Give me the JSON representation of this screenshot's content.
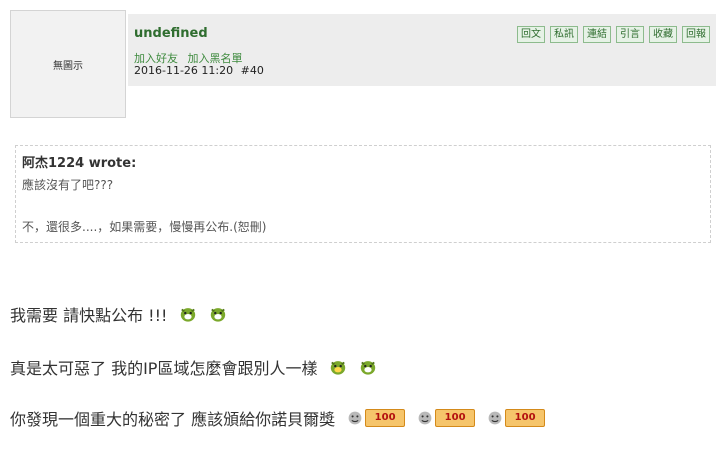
{
  "avatar": {
    "placeholder": "無圖示"
  },
  "header": {
    "username": "undefined",
    "links": [
      "加入好友",
      "加入黑名單"
    ],
    "timestamp": "2016-11-26 11:20",
    "post_number": "#40",
    "actions": [
      "回文",
      "私訊",
      "連結",
      "引言",
      "收藏",
      "回報"
    ]
  },
  "quote": {
    "author": "阿杰1224 wrote:",
    "text": "應該沒有了吧???",
    "reply": "不，還很多....，如果需要，慢慢再公布.(恕刪)"
  },
  "replies": [
    {
      "text": "我需要 請快點公布 !!!",
      "emojis": [
        "alien-face-icon",
        "alien-face-icon"
      ]
    },
    {
      "text": "真是太可惡了 我的IP區域怎麼會跟別人一樣",
      "emojis": [
        "alien-face-icon",
        "alien-face-icon"
      ]
    },
    {
      "text": "你發現一個重大的秘密了 應該頒給你諾貝爾獎",
      "emojis": [
        "score-100-icon",
        "score-100-icon",
        "score-100-icon"
      ]
    }
  ],
  "score_label": "100",
  "colors": {
    "username": "#2f6d2f",
    "header_bg": "#ededed",
    "action_border": "#8dbb8d"
  }
}
